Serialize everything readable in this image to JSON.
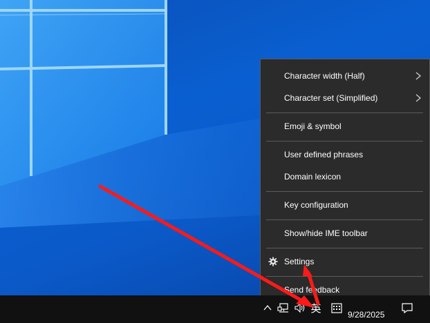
{
  "context_menu": {
    "items": [
      {
        "label": "Character width (Half)",
        "submenu": true
      },
      {
        "label": "Character set (Simplified)",
        "submenu": true
      },
      {
        "label": "Emoji & symbol"
      },
      {
        "label": "User defined phrases"
      },
      {
        "label": "Domain lexicon"
      },
      {
        "label": "Key configuration"
      },
      {
        "label": "Show/hide IME toolbar"
      },
      {
        "label": "Settings",
        "icon": "gear-icon"
      },
      {
        "label": "Send feedback"
      }
    ]
  },
  "taskbar": {
    "ime_mode": "英",
    "date": "9/28/2025",
    "tray_icons": [
      "chevron-up-icon",
      "network-icon",
      "volume-icon",
      "ime-mode-icon",
      "ime-pad-icon",
      "notification-icon"
    ]
  },
  "colors": {
    "menu_background": "#2b2b2b",
    "taskbar_background": "#111111",
    "desktop_blue": "#0a5fd0",
    "annotation_arrow": "#ff1a1a"
  }
}
